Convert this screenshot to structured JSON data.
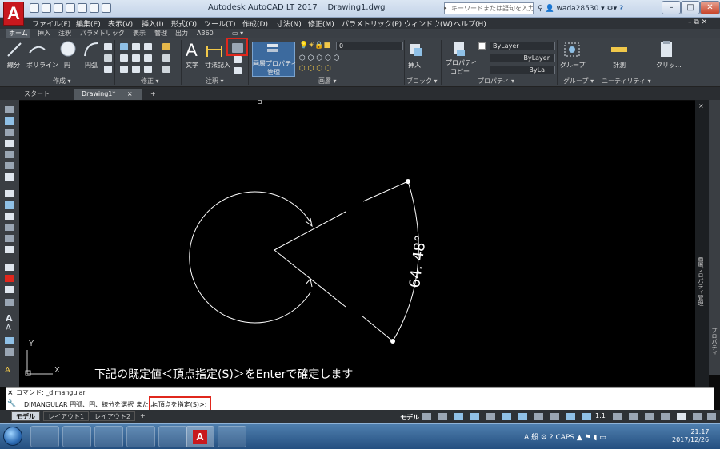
{
  "app_title": "Autodesk AutoCAD LT 2017",
  "file_name": "Drawing1.dwg",
  "search_placeholder": "キーワードまたは語句を入力",
  "user_name": "wada28530",
  "menu": [
    "ファイル(F)",
    "編集(E)",
    "表示(V)",
    "挿入(I)",
    "形式(O)",
    "ツール(T)",
    "作成(D)",
    "寸法(N)",
    "修正(M)",
    "パラメトリック(P)",
    "ウィンドウ(W)",
    "ヘルプ(H)"
  ],
  "ribbon_tabs": [
    "ホーム",
    "挿入",
    "注釈",
    "パラメトリック",
    "表示",
    "管理",
    "出力",
    "A360"
  ],
  "ribbon": {
    "draw_labels": [
      "線分",
      "ポリライン",
      "円",
      "円弧"
    ],
    "text_label": "文字",
    "dim_label": "寸法記入",
    "layer_props_label": [
      "画層プロパティ",
      "管理"
    ],
    "layer_current": "0",
    "insert_label": "挿入",
    "props_copy_label": [
      "プロパティ",
      "コピー"
    ],
    "bylayer_color": "ByLayer",
    "bylayer_linetype": "ByLayer",
    "bylayer_lineweight": "ByLa",
    "group_label": "グループ",
    "measure_label": "計測",
    "clip_label": "クリッ..."
  },
  "panel_titles": [
    "作成 ▾",
    "修正 ▾",
    "注釈 ▾",
    "画層 ▾",
    "ブロック ▾",
    "プロパティ ▾",
    "グループ ▾",
    "ユーティリティ ▾"
  ],
  "file_tabs": {
    "start": "スタート",
    "drawing": "Drawing1*"
  },
  "drawing": {
    "angle_label": "64. 48°",
    "note": "下記の既定値＜頂点指定(S)＞をEnterで確定します"
  },
  "ucs": {
    "x": "X",
    "y": "Y"
  },
  "command": {
    "history": "コマンド: _dimangular",
    "prompt": "DIMANGULAR 円弧、円、線分を選択 または",
    "option": "<頂点を指定(S)>:"
  },
  "model_tabs": [
    "モデル",
    "レイアウト1",
    "レイアウト2"
  ],
  "status": {
    "model": "モデル",
    "scale": "1:1"
  },
  "side_panels": [
    "画層プロパティ管理",
    "プロパティ"
  ],
  "clock": {
    "time": "21:17",
    "date": "2017/12/26"
  },
  "colors": {
    "accent_red": "#e0271c",
    "canvas": "#000000",
    "ribbon": "#3c4147"
  }
}
